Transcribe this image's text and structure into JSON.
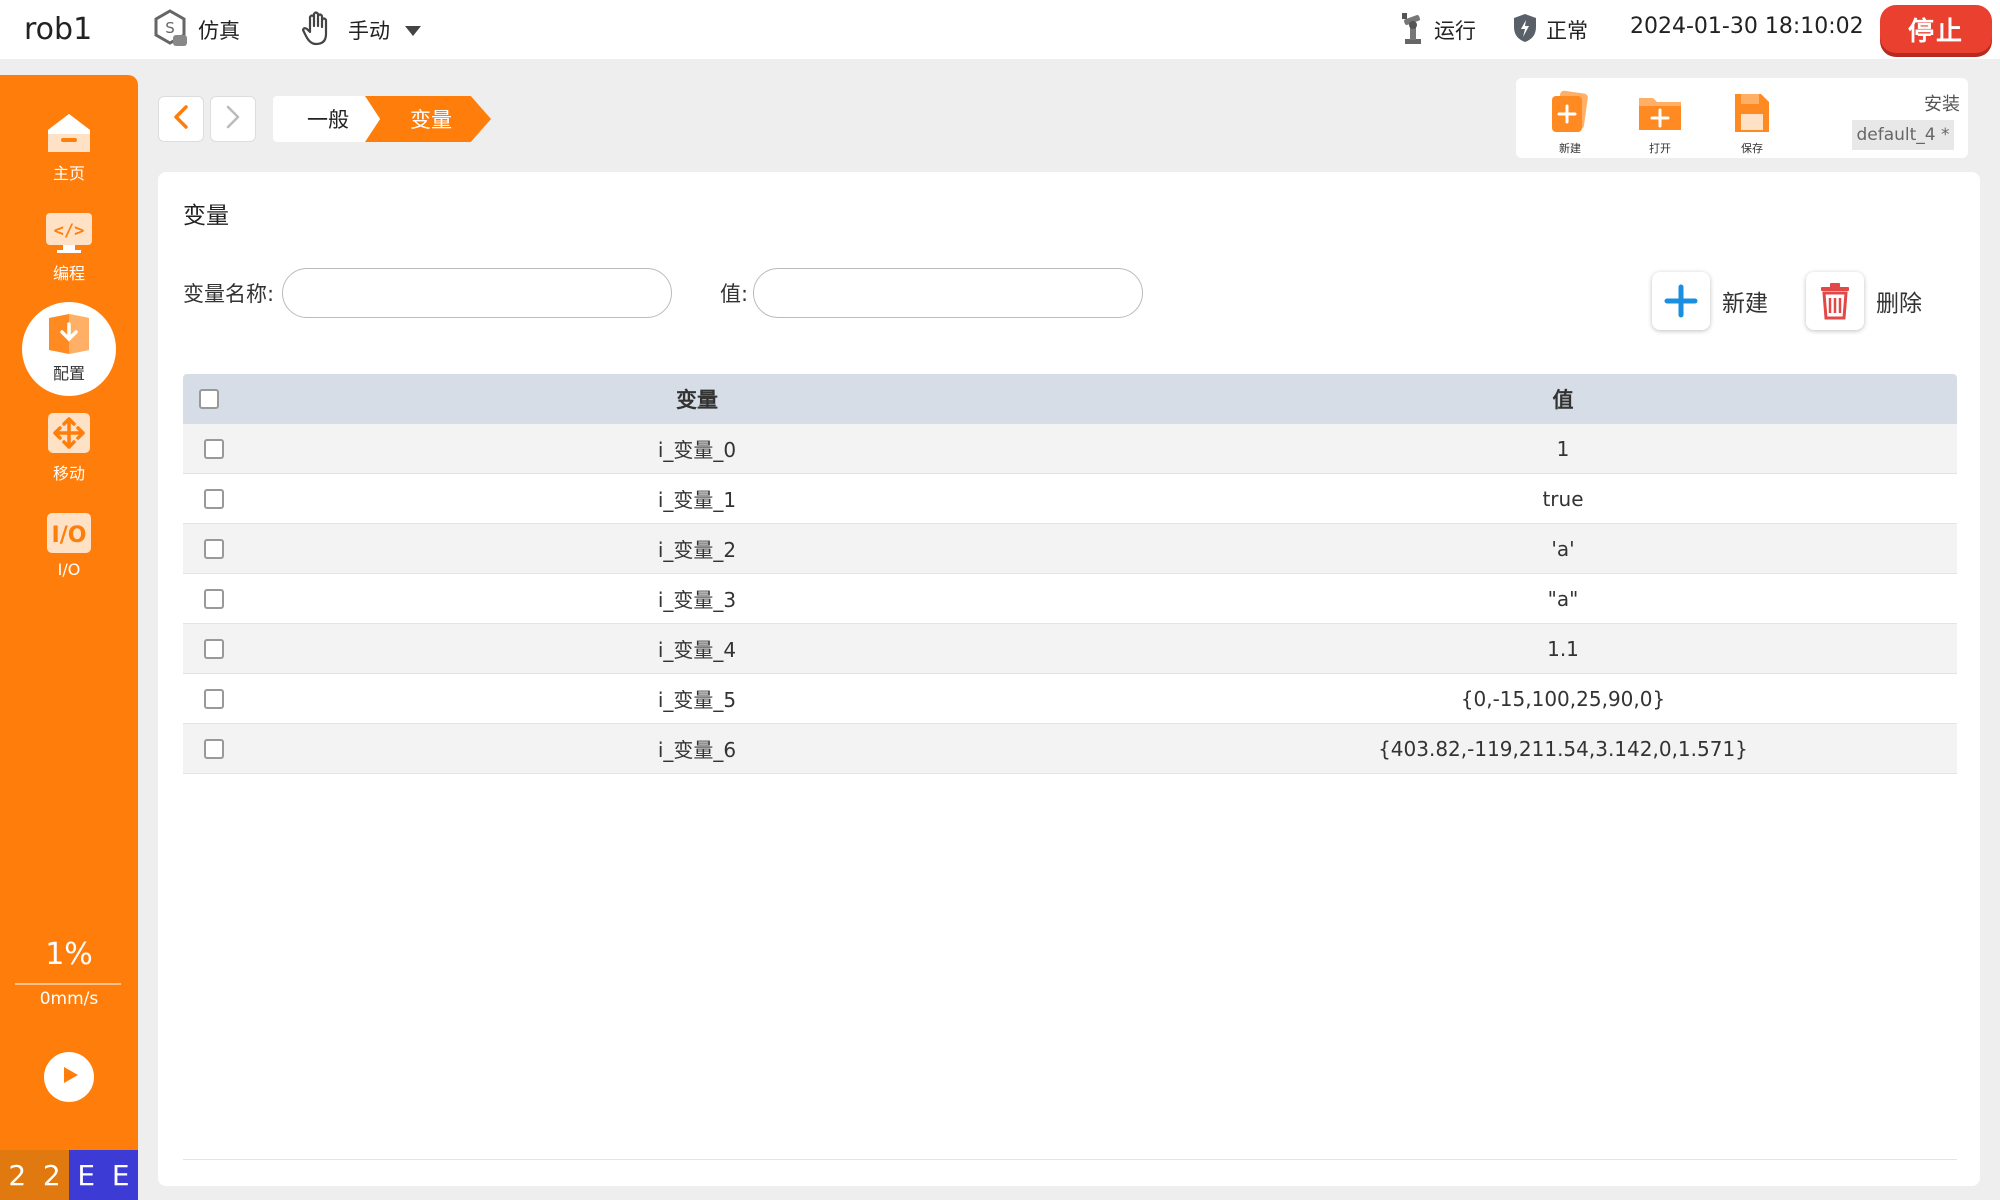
{
  "topbar": {
    "robot_name": "rob1",
    "sim_label": "仿真",
    "manual_label": "手动",
    "run_label": "运行",
    "safety_label": "正常",
    "datetime": "2024-01-30 18:10:02",
    "stop_label": "停止"
  },
  "sidebar": {
    "items": [
      {
        "label": "主页",
        "icon": "home-icon"
      },
      {
        "label": "编程",
        "icon": "code-icon"
      },
      {
        "label": "配置",
        "icon": "config-icon"
      },
      {
        "label": "移动",
        "icon": "move-icon"
      },
      {
        "label": "I/O",
        "icon": "io-icon"
      }
    ],
    "active": "配置",
    "speed_percent": "1%",
    "speed_mms": "0mm/s",
    "status_cells": [
      {
        "text": "2",
        "color": "#e07a10"
      },
      {
        "text": "2",
        "color": "#e07a10"
      },
      {
        "text": "E",
        "color": "#3d3bd6"
      },
      {
        "text": "E",
        "color": "#3d3bd6"
      }
    ]
  },
  "breadcrumb": {
    "items": [
      "一般",
      "变量"
    ]
  },
  "file_toolbar": {
    "new_label": "新建",
    "open_label": "打开",
    "save_label": "保存",
    "install_label": "安装",
    "install_config": "default_4 *"
  },
  "panel": {
    "title": "变量",
    "name_label": "变量名称:",
    "name_value": "",
    "value_label": "值:",
    "value_value": "",
    "new_button": "新建",
    "delete_button": "删除"
  },
  "table": {
    "headers": [
      "变量",
      "值"
    ],
    "rows": [
      {
        "name": "i_变量_0",
        "value": "1"
      },
      {
        "name": "i_变量_1",
        "value": "true"
      },
      {
        "name": "i_变量_2",
        "value": "'a'"
      },
      {
        "name": "i_变量_3",
        "value": "\"a\""
      },
      {
        "name": "i_变量_4",
        "value": "1.1"
      },
      {
        "name": "i_变量_5",
        "value": "{0,-15,100,25,90,0}"
      },
      {
        "name": "i_变量_6",
        "value": "{403.82,-119,211.54,3.142,0,1.571}"
      }
    ]
  },
  "colors": {
    "accent": "#ff7e0b",
    "stop": "#e9402f",
    "table_header": "#d7dde6",
    "add_icon": "#1a8fe0",
    "delete_icon": "#e24848"
  }
}
